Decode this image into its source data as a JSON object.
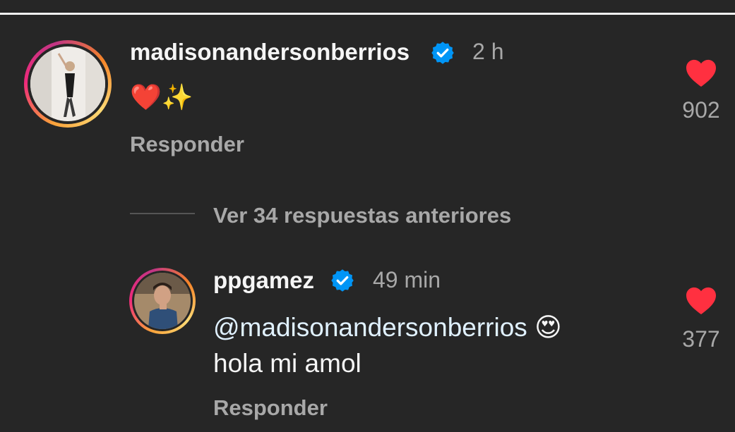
{
  "comment": {
    "username": "madisonandersonberrios",
    "time": "2 h",
    "text_emoji": "❤️✨",
    "reply_label": "Responder",
    "like_count": "902",
    "verified_color": "#0095f6",
    "heart_color": "#ff3040"
  },
  "view_replies": {
    "label": "Ver 34 respuestas anteriores"
  },
  "reply": {
    "username": "ppgamez",
    "time": "49 min",
    "mention": "@madisonandersonberrios",
    "emoji": "😍",
    "text": "hola mi amol",
    "reply_label": "Responder",
    "like_count": "377"
  }
}
